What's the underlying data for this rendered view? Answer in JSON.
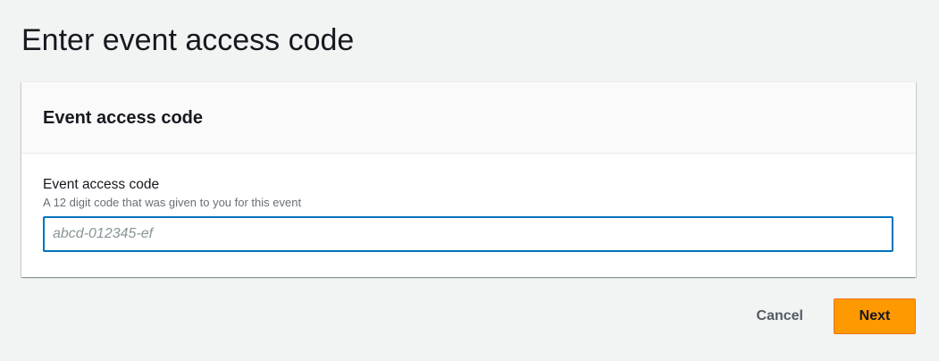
{
  "page": {
    "title": "Enter event access code"
  },
  "container": {
    "header_title": "Event access code",
    "field": {
      "label": "Event access code",
      "description": "A 12 digit code that was given to you for this event",
      "value": "",
      "placeholder": "abcd-012345-ef"
    }
  },
  "actions": {
    "cancel_label": "Cancel",
    "next_label": "Next"
  },
  "colors": {
    "background": "#f2f3f3",
    "primary_button": "#ff9900",
    "input_focus_border": "#0073bb",
    "text": "#16191f",
    "secondary_text": "#687078"
  }
}
